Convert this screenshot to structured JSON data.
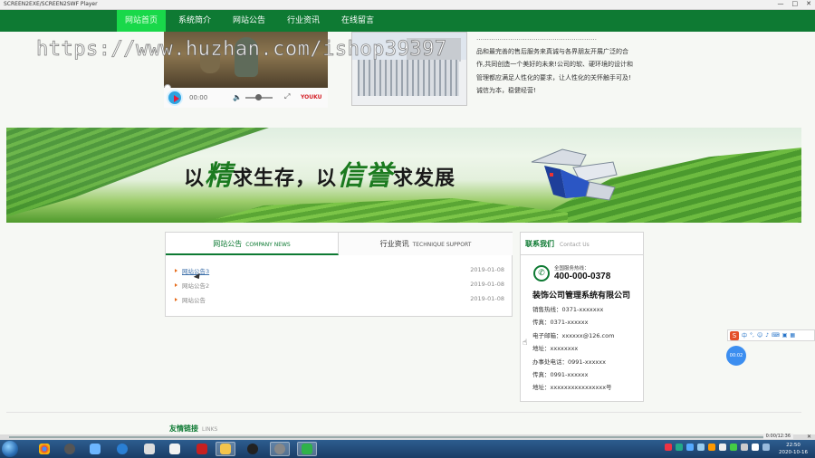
{
  "window": {
    "title": "SCREEN2EXE/SCREEN2SWF Player",
    "controls": [
      "—",
      "□",
      "✕"
    ]
  },
  "nav": {
    "items": [
      "网站首页",
      "系统简介",
      "网站公告",
      "行业资讯",
      "在线留言"
    ],
    "active_index": 0
  },
  "video": {
    "time": "00:00",
    "brand": "YOUKU"
  },
  "intro": {
    "lines": [
      "…………………………………………………",
      "品和最完善的售后服务来真诚与各界朋友开展广泛的合",
      "作,共同创造一个美好的未来!公司的软、硬环境的设计和",
      "管理都应满足人性化的要求，让人性化的关怀触手可及!",
      "诚信为本，稳健经营!"
    ]
  },
  "watermark": "https://www.huzhan.com/ishop39397",
  "banner": {
    "slogan_parts": [
      "以",
      "精",
      "求生存，以",
      "信誉",
      "求发展"
    ]
  },
  "news": {
    "tab1": {
      "label": "网站公告",
      "en": "COMPANY NEWS"
    },
    "tab2": {
      "label": "行业资讯",
      "en": "TECHNIQUE SUPPORT"
    },
    "items": [
      {
        "title": "网站公告3",
        "date": "2019-01-08"
      },
      {
        "title": "网站公告2",
        "date": "2019-01-08"
      },
      {
        "title": "网站公告",
        "date": "2019-01-08"
      }
    ]
  },
  "contact": {
    "heading": "联系我们",
    "heading_en": "Contact Us",
    "hotline_label": "全国服务热线：",
    "hotline": "400-000-0378",
    "company": "装饰公司管理系统有限公司",
    "lines": [
      "销售热线：0371-xxxxxxx",
      "传真：0371-xxxxxx",
      "电子邮箱：xxxxxx@126.com",
      "地址：xxxxxxxx",
      "办事处电话：0991-xxxxxx",
      "传真：0991-xxxxxx",
      "地址：xxxxxxxxxxxxxxxx号"
    ]
  },
  "friends": {
    "label": "友情链接",
    "en": "LINKS"
  },
  "ime": {
    "label": "中"
  },
  "bubble": {
    "label": "00:02"
  },
  "playerbar": {
    "info": "0:00/12:36"
  },
  "taskbar": {
    "time": "22:50",
    "date": "2020-10-16"
  },
  "colors": {
    "brand_green": "#0e7a33",
    "active_nav": "#19d84a",
    "accent_orange": "#e66b1a"
  }
}
